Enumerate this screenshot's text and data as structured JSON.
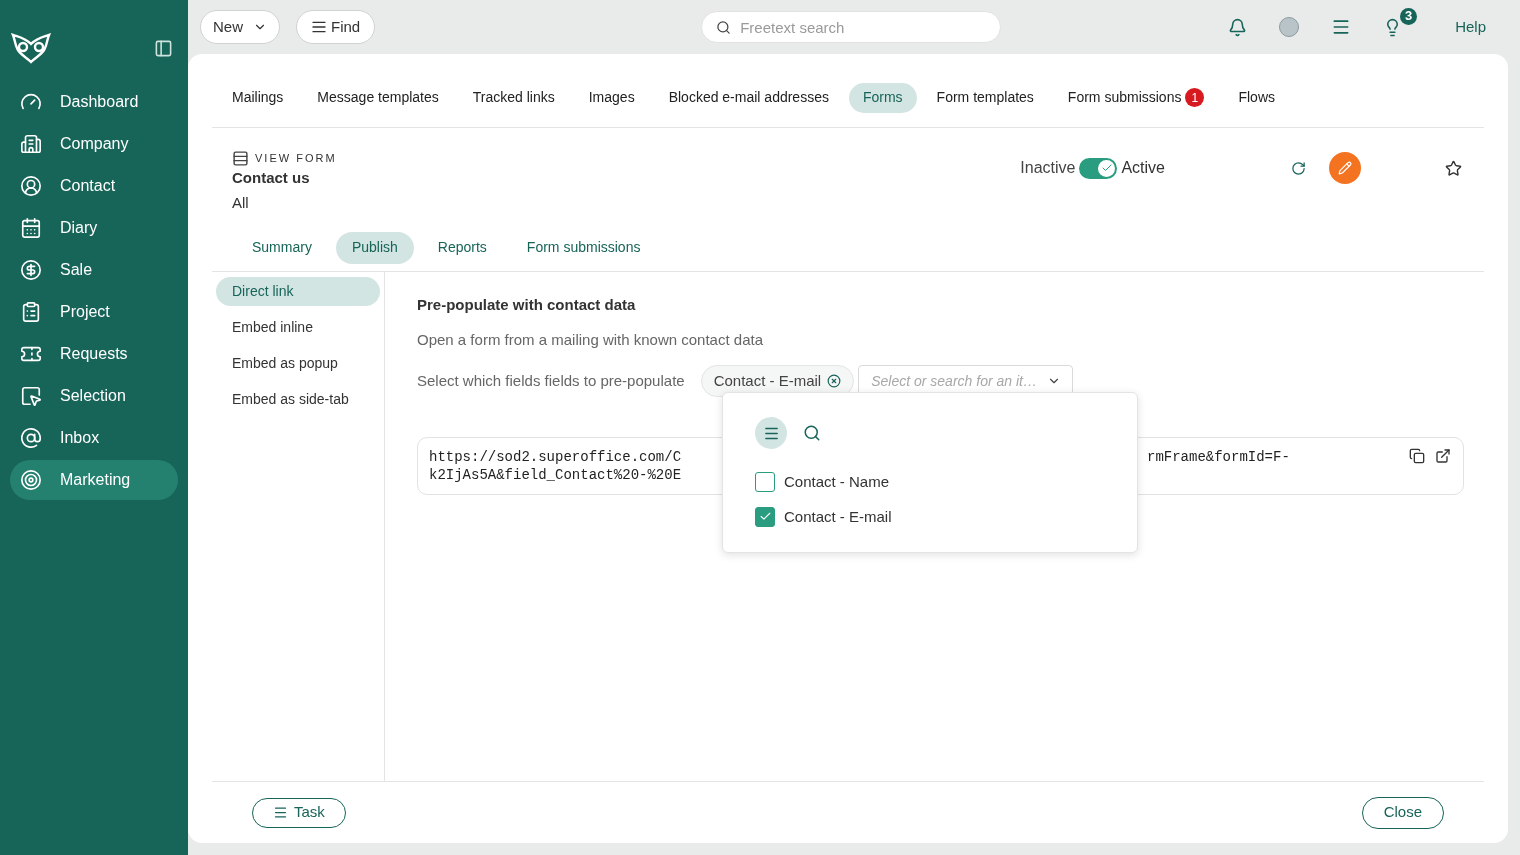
{
  "sidebar": {
    "items": [
      {
        "label": "Dashboard",
        "selected": false
      },
      {
        "label": "Company",
        "selected": false
      },
      {
        "label": "Contact",
        "selected": false
      },
      {
        "label": "Diary",
        "selected": false
      },
      {
        "label": "Sale",
        "selected": false
      },
      {
        "label": "Project",
        "selected": false
      },
      {
        "label": "Requests",
        "selected": false
      },
      {
        "label": "Selection",
        "selected": false
      },
      {
        "label": "Inbox",
        "selected": false
      },
      {
        "label": "Marketing",
        "selected": true
      }
    ]
  },
  "toolbar": {
    "new_button": "New",
    "find_button": "Find",
    "search": {
      "placeholder": "Freetext search"
    },
    "tips_count": "3",
    "help_link": "Help"
  },
  "tabs": [
    {
      "label": "Mailings",
      "selected": false
    },
    {
      "label": "Message templates",
      "selected": false
    },
    {
      "label": "Tracked links",
      "selected": false
    },
    {
      "label": "Images",
      "selected": false
    },
    {
      "label": "Blocked e-mail addresses",
      "selected": false
    },
    {
      "label": "Forms",
      "selected": true
    },
    {
      "label": "Form templates",
      "selected": false
    },
    {
      "label": "Form submissions",
      "selected": false,
      "badge": "1"
    },
    {
      "label": "Flows",
      "selected": false
    }
  ],
  "header": {
    "caption": "VIEW FORM",
    "title": "Contact us",
    "subtitle": "All",
    "status": {
      "off_label": "Inactive",
      "on_label": "Active",
      "on": true
    }
  },
  "subtabs": [
    {
      "label": "Summary",
      "selected": false
    },
    {
      "label": "Publish",
      "selected": true
    },
    {
      "label": "Reports",
      "selected": false
    },
    {
      "label": "Form submissions",
      "selected": false
    }
  ],
  "publish_menu": [
    {
      "label": "Direct link",
      "selected": true
    },
    {
      "label": "Embed inline",
      "selected": false
    },
    {
      "label": "Embed as popup",
      "selected": false
    },
    {
      "label": "Embed as side-tab",
      "selected": false
    }
  ],
  "section": {
    "title": "Pre-populate with contact data",
    "description": "Open a form from a mailing with known contact data",
    "fields_label": "Select which fields fields to pre-populate",
    "selected_chips": [
      {
        "label": "Contact - E-mail"
      }
    ],
    "select_placeholder": "Select or search for an it…",
    "dropdown": {
      "options": [
        {
          "label": "Contact - Name",
          "checked": false
        },
        {
          "label": "Contact - E-mail",
          "checked": true
        }
      ]
    },
    "url": {
      "line_1_start": "https://sod2.superoffice.com/C",
      "line_2_start": "k2IjAs5A&field_Contact%20-%20E",
      "line_1_end": "rmFrame&formId=F-"
    }
  },
  "footer": {
    "task_button": "Task",
    "close_button": "Close"
  }
}
